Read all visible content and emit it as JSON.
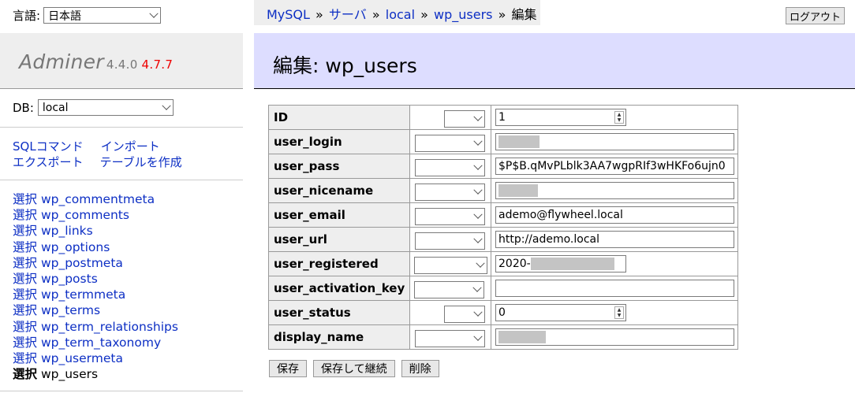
{
  "lang": {
    "label": "言語:",
    "value": "日本語"
  },
  "logo": {
    "name": "Adminer",
    "version": "4.4.0",
    "new_version": "4.7.7"
  },
  "db": {
    "label": "DB:",
    "value": "local"
  },
  "links": {
    "sql": "SQLコマンド",
    "import": "インポート",
    "export": "エクスポート",
    "create": "テーブルを作成"
  },
  "tables": [
    {
      "select": "選択",
      "name": "wp_commentmeta"
    },
    {
      "select": "選択",
      "name": "wp_comments"
    },
    {
      "select": "選択",
      "name": "wp_links"
    },
    {
      "select": "選択",
      "name": "wp_options"
    },
    {
      "select": "選択",
      "name": "wp_postmeta"
    },
    {
      "select": "選択",
      "name": "wp_posts"
    },
    {
      "select": "選択",
      "name": "wp_termmeta"
    },
    {
      "select": "選択",
      "name": "wp_terms"
    },
    {
      "select": "選択",
      "name": "wp_term_relationships"
    },
    {
      "select": "選択",
      "name": "wp_term_taxonomy"
    },
    {
      "select": "選択",
      "name": "wp_usermeta"
    },
    {
      "select": "選択",
      "name": "wp_users"
    }
  ],
  "breadcrumb": {
    "mysql": "MySQL",
    "server": "サーバ",
    "db": "local",
    "table": "wp_users",
    "current": "編集",
    "sep": "»"
  },
  "logout": "ログアウト",
  "title": "編集: wp_users",
  "fields": [
    {
      "name": "ID",
      "value": "1"
    },
    {
      "name": "user_login",
      "value": ""
    },
    {
      "name": "user_pass",
      "value": "$P$B.qMvPLblk3AA7wgpRIf3wHKFo6ujn0"
    },
    {
      "name": "user_nicename",
      "value": ""
    },
    {
      "name": "user_email",
      "value": "ademo@flywheel.local"
    },
    {
      "name": "user_url",
      "value": "http://ademo.local"
    },
    {
      "name": "user_registered",
      "value": "2020-"
    },
    {
      "name": "user_activation_key",
      "value": ""
    },
    {
      "name": "user_status",
      "value": "0"
    },
    {
      "name": "display_name",
      "value": ""
    }
  ],
  "buttons": {
    "save": "保存",
    "save_continue": "保存して継続",
    "delete": "削除"
  }
}
